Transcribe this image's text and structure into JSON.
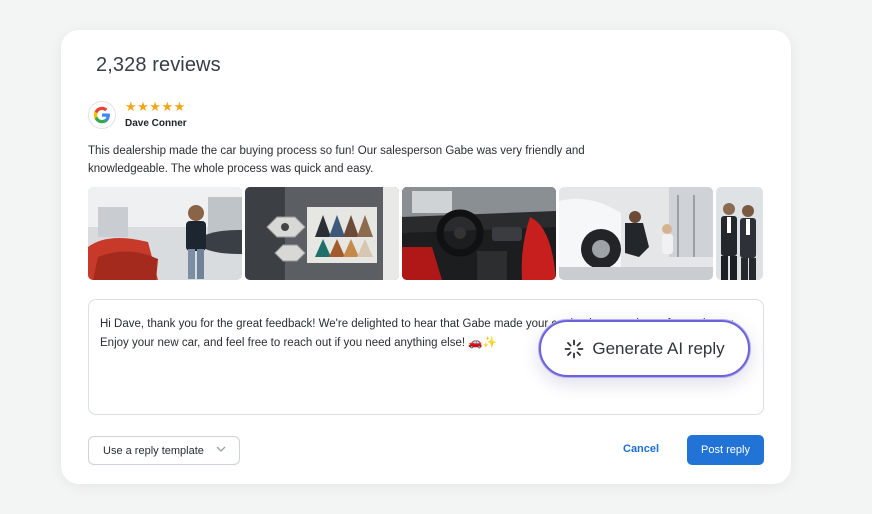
{
  "review_count": "2,328 reviews",
  "review": {
    "source_icon": "google-g-icon",
    "stars": "★★★★★",
    "rating": 5,
    "reviewer_name": "Dave Conner",
    "text": "This dealership made the car buying process so fun! Our salesperson Gabe was very friendly and knowledgeable. The whole process was quick and easy."
  },
  "photos": [
    {
      "name": "review-photo-showroom-woman"
    },
    {
      "name": "review-photo-color-swatches"
    },
    {
      "name": "review-photo-car-interior"
    },
    {
      "name": "review-photo-tire-check"
    },
    {
      "name": "review-photo-salesmen"
    }
  ],
  "reply": {
    "text": "Hi Dave, thank you for the great feedback! We're delighted to hear that Gabe made your car buying experience fun and easy. Enjoy your new car, and feel free to reach out if you need anything else! 🚗✨"
  },
  "actions": {
    "generate_ai_label": "Generate AI reply",
    "template_label": "Use a reply template",
    "cancel_label": "Cancel",
    "post_label": "Post reply"
  },
  "colors": {
    "accent": "#2173d5",
    "stars": "#f2a516",
    "ai_border": "#6c63d9"
  }
}
